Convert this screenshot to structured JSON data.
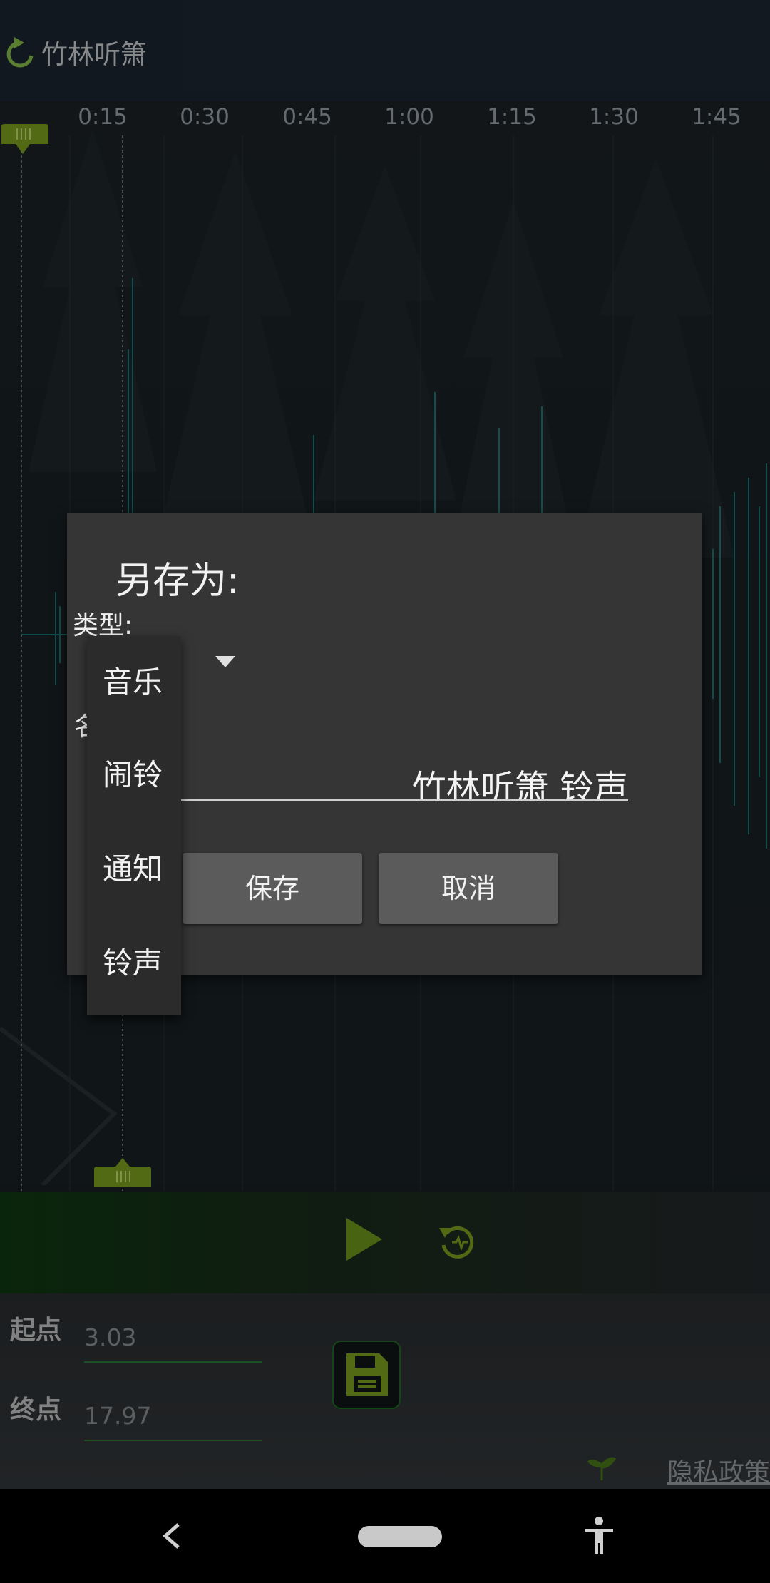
{
  "app": {
    "title": "竹林听箫"
  },
  "timeline": {
    "ticks": [
      "0:15",
      "0:30",
      "0:45",
      "1:00",
      "1:15",
      "1:30",
      "1:45"
    ]
  },
  "fields": {
    "start_label": "起点",
    "start_value": "3.03",
    "end_label": "终点",
    "end_value": "17.97"
  },
  "privacy_link": "隐私政策",
  "dialog": {
    "title": "另存为:",
    "type_label": "类型:",
    "name_label_partial": "名",
    "name_value": "竹林听箫 铃声",
    "save_label": "保存",
    "cancel_label": "取消"
  },
  "dropdown": {
    "options": [
      "音乐",
      "闹铃",
      "通知",
      "铃声"
    ]
  },
  "colors": {
    "accent_green": "#8bc34a",
    "wave_teal": "#1e8d8f",
    "dialog_bg": "#353535"
  },
  "icons": [
    "back-arrow-icon",
    "play-icon",
    "replay-icon",
    "save-icon",
    "leaf-icon",
    "accessibility-icon"
  ]
}
